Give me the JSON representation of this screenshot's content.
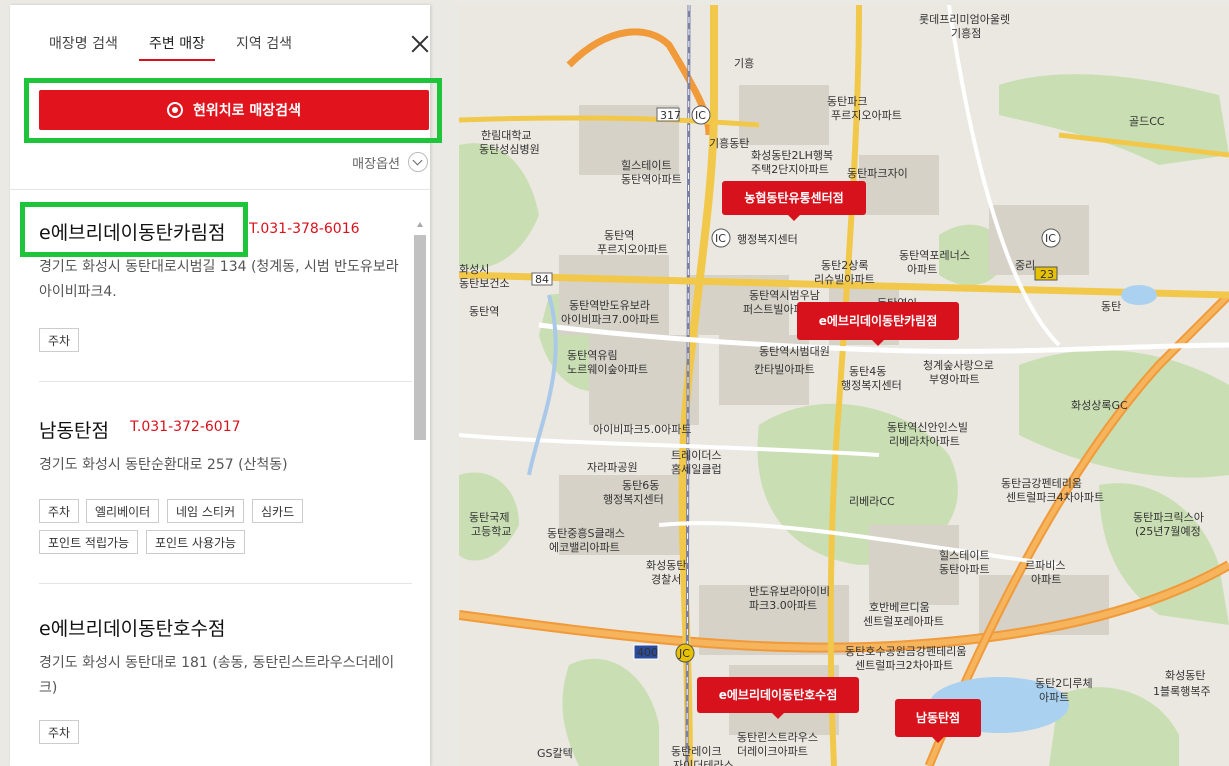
{
  "tabs": [
    {
      "label": "매장명 검색"
    },
    {
      "label": "주변 매장"
    },
    {
      "label": "지역 검색"
    }
  ],
  "locate_button_label": "현위치로 매장검색",
  "store_options_label": "매장옵션",
  "stores": [
    {
      "name": "e에브리데이동탄카림점",
      "phone": "T.031-378-6016",
      "address": "경기도 화성시 동탄대로시범길 134 (청계동, 시범 반도유보라아이비파크4.",
      "tags": [
        "주차"
      ]
    },
    {
      "name": "남동탄점",
      "phone": "T.031-372-6017",
      "address": "경기도 화성시 동탄순환대로 257 (산척동)",
      "tags": [
        "주차",
        "엘리베이터",
        "네임 스티커",
        "심카드",
        "포인트 적립가능",
        "포인트 사용가능"
      ]
    },
    {
      "name": "e에브리데이동탄호수점",
      "phone": "",
      "address": "경기도 화성시 동탄대로 181 (송동, 동탄린스트라우스더레이크)",
      "tags": [
        "주차"
      ]
    }
  ],
  "map": {
    "pins": [
      {
        "label": "농협동탄유통센터점"
      },
      {
        "label": "e에브리데이동탄카림점"
      },
      {
        "label": "e에브리데이동탄호수점"
      },
      {
        "label": "남동탄점"
      }
    ],
    "road_badges": [
      "317",
      "IC",
      "IC",
      "IC",
      "23",
      "84",
      "400",
      "JC"
    ],
    "labels": [
      "롯데프리미엄아울렛",
      "기흥점",
      "기흥",
      "기흥동탄",
      "동탄파크",
      "푸르지오아파트",
      "골드CC",
      "한림대학교",
      "동탄성심병원",
      "힐스테이트",
      "동탄역아파트",
      "화성동탄2LH행복",
      "주택2단지아파트",
      "동탄파크자이",
      "동탄역",
      "푸르지오아파트",
      "행정복지센터",
      "동탄2상록",
      "리슈빌아파트",
      "동탄역포레너스",
      "아파트",
      "중리",
      "동탄",
      "화성시",
      "동탄보건소",
      "동탄역반도유보라",
      "아이비파크7.0아파트",
      "동탄역시범우남",
      "퍼스트빌아파트",
      "동탄역아",
      "동탄역유림",
      "노르웨이숲아파트",
      "칸타빌아파트",
      "동탄4동",
      "행정복지센터",
      "청계숲사랑으로",
      "부영아파트",
      "화성상록GC",
      "아이비파크5.0아파트",
      "동탄역신안인스빌",
      "리베라차아파트",
      "트레이더스",
      "홈세일클럽",
      "자라파공원",
      "동탄6동",
      "행정복지센터",
      "동탄금강펜테리움",
      "센트럴파크4차아파트",
      "리베라CC",
      "동탄국제",
      "고등학교",
      "동탄중흥S클래스",
      "에코밸리아파트",
      "동탄파크릭스아",
      "(25년7월예정",
      "화성동탄",
      "경찰서",
      "힐스테이트",
      "동탄아파트",
      "르파비스",
      "아파트",
      "반도유보라아이비",
      "파크3.0아파트",
      "호반베르디움",
      "센트럴포레아파트",
      "동탄호수공원금강펜테리움",
      "센트럴파크2차아파트",
      "동탄2디루체",
      "아파트",
      "화성동탄",
      "1블록행복주",
      "동탄린스트라우스",
      "더레이크아파트",
      "동탄레이크",
      "자이더테라스",
      "GS칼텍",
      "동탄역",
      "동탄역시범대원"
    ]
  }
}
